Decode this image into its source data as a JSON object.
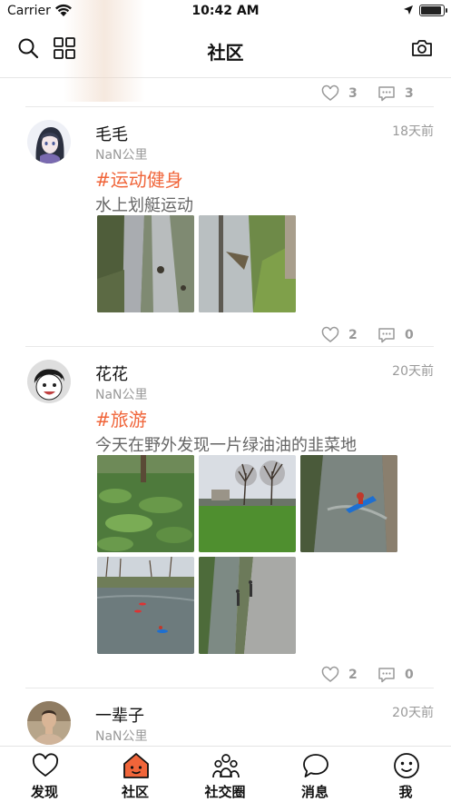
{
  "status_bar": {
    "carrier": "Carrier",
    "time": "10:42 AM"
  },
  "nav": {
    "title": "社区",
    "left_icons": [
      "search-icon",
      "grid-icon"
    ],
    "right_icon": "camera-icon"
  },
  "feed": {
    "top_stats": {
      "likes": "3",
      "comments": "3"
    },
    "posts": [
      {
        "author": "毛毛",
        "time": "18天前",
        "distance": "NaN公里",
        "tag": "#运动健身",
        "content": "水上划艇运动",
        "photos": [
          "river-path-photo",
          "river-bank-photo"
        ],
        "likes": "2",
        "comments": "0"
      },
      {
        "author": "花花",
        "time": "20天前",
        "distance": "NaN公里",
        "tag": "#旅游",
        "content": "今天在野外发现一片绿油油的韭菜地",
        "photos": [
          "wild-garlic-photo",
          "field-trees-photo",
          "kayak-river-photo",
          "kayak-lake-photo",
          "riverside-path-photo"
        ],
        "likes": "2",
        "comments": "0"
      },
      {
        "author": "一辈子",
        "time": "20天前",
        "distance": "NaN公里"
      }
    ]
  },
  "tabs": [
    {
      "label": "发现",
      "icon": "heart-icon"
    },
    {
      "label": "社区",
      "icon": "house-face-icon",
      "active": true
    },
    {
      "label": "社交圈",
      "icon": "people-icon"
    },
    {
      "label": "消息",
      "icon": "chat-bubble-icon"
    },
    {
      "label": "我",
      "icon": "smiley-icon"
    }
  ],
  "colors": {
    "accent": "#f0653a",
    "muted": "#999999",
    "divider": "#e8e8e8"
  }
}
